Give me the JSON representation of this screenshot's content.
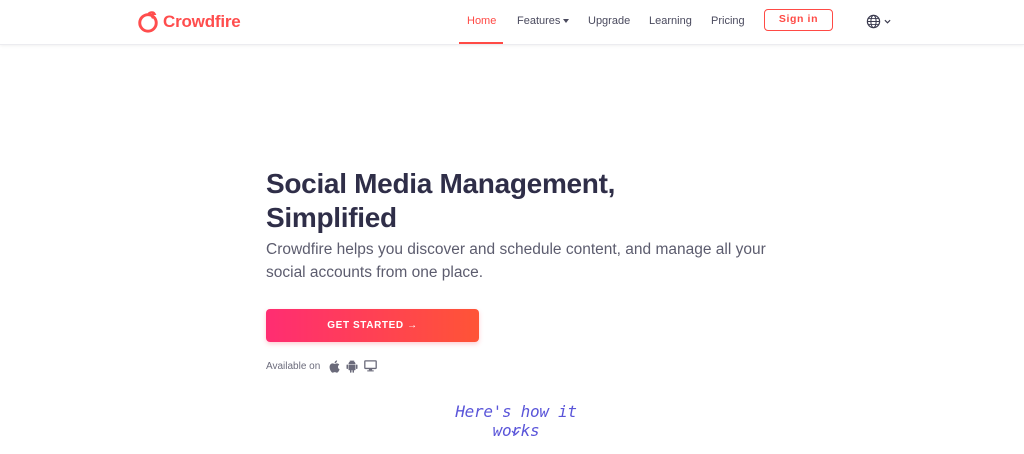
{
  "brand": {
    "name": "Crowdfire",
    "color": "#ff4d4d"
  },
  "nav": {
    "items": [
      {
        "label": "Home",
        "active": true
      },
      {
        "label": "Features",
        "dropdown": true
      },
      {
        "label": "Upgrade"
      },
      {
        "label": "Learning"
      },
      {
        "label": "Pricing"
      }
    ],
    "signin_label": "Sign in",
    "language_icon": "globe-icon"
  },
  "hero": {
    "title_line1": "Social Media Management,",
    "title_line2": "Simplified",
    "subtitle_line1": "Crowdfire helps you discover and schedule content, and manage all your",
    "subtitle_line2": "social accounts from one place.",
    "cta_label": "GET STARTED →",
    "available_label": "Available on",
    "platforms": [
      "apple-icon",
      "android-icon",
      "desktop-icon"
    ]
  },
  "how_it_works": {
    "label": "Here's how it works",
    "icon": "chevron-down-icon"
  },
  "colors": {
    "accent": "#ff4a45",
    "cta_start": "#ff2d72",
    "cta_end": "#ff5436",
    "how_color": "#5a55d9",
    "heading": "#2f2e48"
  }
}
